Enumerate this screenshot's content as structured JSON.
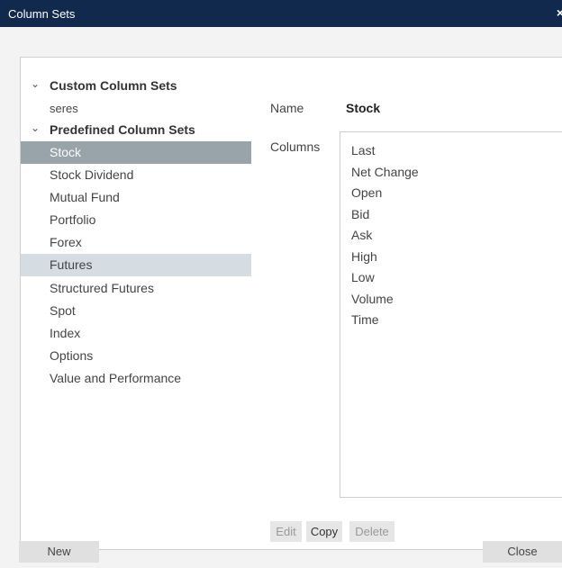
{
  "window": {
    "title": "Column Sets",
    "close_glyph": "×"
  },
  "tree": {
    "custom_header": "Custom Column Sets",
    "custom_items": [
      "seres"
    ],
    "predefined_header": "Predefined Column Sets",
    "predefined_items": [
      "Stock",
      "Stock Dividend",
      "Mutual Fund",
      "Portfolio",
      "Forex",
      "Futures",
      "Structured Futures",
      "Spot",
      "Index",
      "Options",
      "Value and Performance"
    ],
    "selected": "Stock",
    "hovered": "Futures"
  },
  "detail": {
    "name_label": "Name",
    "name_value": "Stock",
    "columns_label": "Columns",
    "columns": [
      "Last",
      "Net Change",
      "Open",
      "Bid",
      "Ask",
      "High",
      "Low",
      "Volume",
      "Time"
    ]
  },
  "actions": {
    "edit": "Edit",
    "copy": "Copy",
    "delete": "Delete",
    "new": "New",
    "close": "Close"
  },
  "colors": {
    "titlebar": "#10294d",
    "selected_row": "#98a3aa",
    "hover_row": "#d5dde3"
  }
}
